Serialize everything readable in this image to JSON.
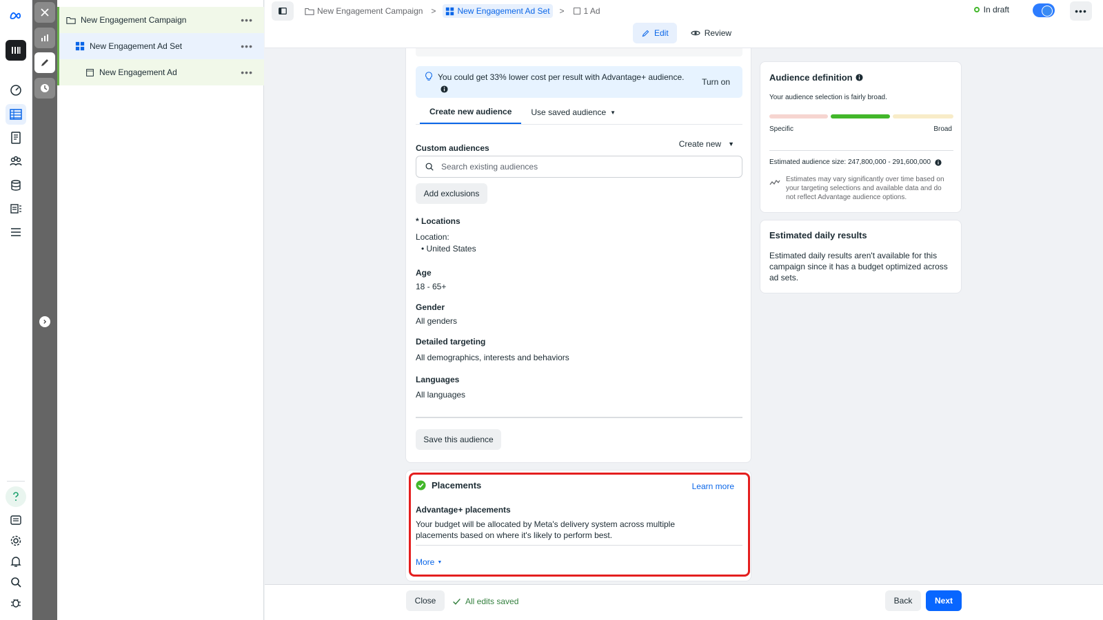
{
  "tree": {
    "campaign": "New Engagement Campaign",
    "adset": "New Engagement Ad Set",
    "ad": "New Engagement Ad"
  },
  "breadcrumb": {
    "campaign": "New Engagement Campaign",
    "adset": "New Engagement Ad Set",
    "ads": "1 Ad"
  },
  "status": {
    "label": "In draft"
  },
  "modes": {
    "edit": "Edit",
    "review": "Review"
  },
  "tip": {
    "text": "You could get 33% lower cost per result with Advantage+ audience.",
    "action": "Turn on"
  },
  "audience_tabs": {
    "create": "Create new audience",
    "saved": "Use saved audience"
  },
  "custom_audiences": {
    "label": "Custom audiences",
    "create_new": "Create new",
    "search_placeholder": "Search existing audiences",
    "add_exclusions": "Add exclusions"
  },
  "locations": {
    "label": "* Locations",
    "sub": "Location:",
    "item": "United States"
  },
  "age": {
    "label": "Age",
    "value": "18 - 65+"
  },
  "gender": {
    "label": "Gender",
    "value": "All genders"
  },
  "detailed": {
    "label": "Detailed targeting",
    "value": "All demographics, interests and behaviors"
  },
  "languages": {
    "label": "Languages",
    "value": "All languages"
  },
  "save_audience": "Save this audience",
  "placements": {
    "title": "Placements",
    "learn_more": "Learn more",
    "subtitle": "Advantage+ placements",
    "description": "Your budget will be allocated by Meta's delivery system across multiple placements based on where it's likely to perform best.",
    "more": "More"
  },
  "audience_definition": {
    "title": "Audience definition",
    "subtitle": "Your audience selection is fairly broad.",
    "specific": "Specific",
    "broad": "Broad",
    "size": "Estimated audience size: 247,800,000 - 291,600,000",
    "note": "Estimates may vary significantly over time based on your targeting selections and available data and do not reflect Advantage audience options."
  },
  "daily_results": {
    "title": "Estimated daily results",
    "text": "Estimated daily results aren't available for this campaign since it has a budget optimized across ad sets."
  },
  "footer": {
    "close": "Close",
    "saved": "All edits saved",
    "back": "Back",
    "next": "Next"
  },
  "colors": {
    "accent": "#0866ff",
    "success": "#42b72a",
    "highlight": "#e41e1e"
  }
}
